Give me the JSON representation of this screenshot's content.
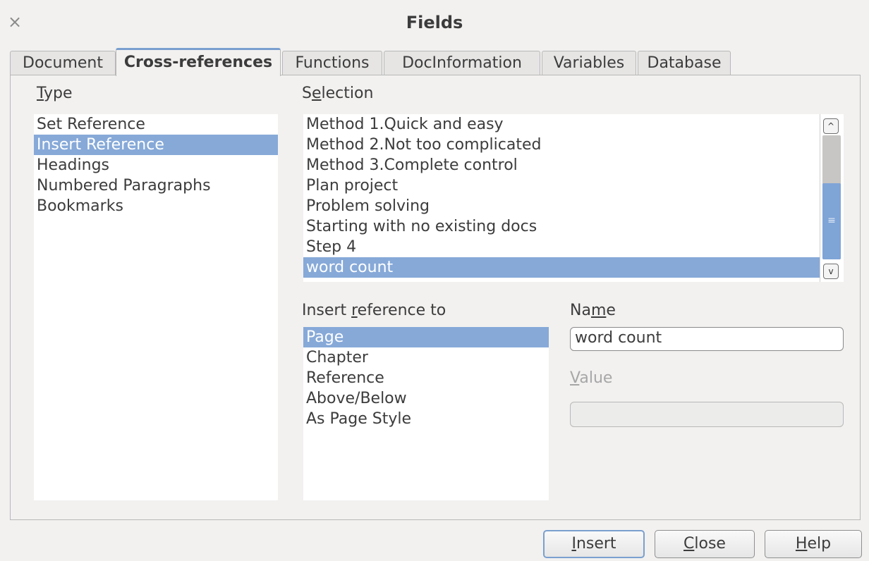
{
  "window": {
    "title": "Fields",
    "close_glyph": "×"
  },
  "tabs": [
    {
      "label": "Document"
    },
    {
      "label": "Cross-references"
    },
    {
      "label": "Functions"
    },
    {
      "label": "DocInformation"
    },
    {
      "label": "Variables"
    },
    {
      "label": "Database"
    }
  ],
  "type_section": {
    "label_mnemonic": "T",
    "label_rest": "ype",
    "items": [
      "Set Reference",
      "Insert Reference",
      "Headings",
      "Numbered Paragraphs",
      "Bookmarks"
    ],
    "selected": "Insert Reference"
  },
  "selection_section": {
    "label_pre": "S",
    "label_mnemonic": "e",
    "label_rest": "lection",
    "items": [
      "Method 1.Quick and easy",
      "Method 2.Not too complicated",
      "Method 3.Complete control",
      "Plan project",
      "Problem solving",
      "Starting with no existing docs",
      "Step 4",
      "word count"
    ],
    "selected": "word count",
    "scrollbar": {
      "up_glyph": "^",
      "down_glyph": "v",
      "grip_glyph": "≡"
    }
  },
  "insert_ref_section": {
    "label_pre": "Insert ",
    "label_mnemonic": "r",
    "label_rest": "eference to",
    "items": [
      "Page",
      "Chapter",
      "Reference",
      "Above/Below",
      "As Page Style"
    ],
    "selected": "Page"
  },
  "name_field": {
    "label_pre": "Na",
    "label_mnemonic": "m",
    "label_rest": "e",
    "value": "word count"
  },
  "value_field": {
    "label_mnemonic": "V",
    "label_rest": "alue",
    "value": "",
    "enabled": false
  },
  "buttons": {
    "insert": {
      "mnemonic": "I",
      "rest": "nsert"
    },
    "close": {
      "mnemonic": "C",
      "rest": "lose"
    },
    "help": {
      "mnemonic": "H",
      "rest": "elp"
    }
  },
  "colors": {
    "selection": "#86a9d8",
    "tab_accent": "#7aa0cf",
    "dialog_bg": "#f2f1f0"
  }
}
